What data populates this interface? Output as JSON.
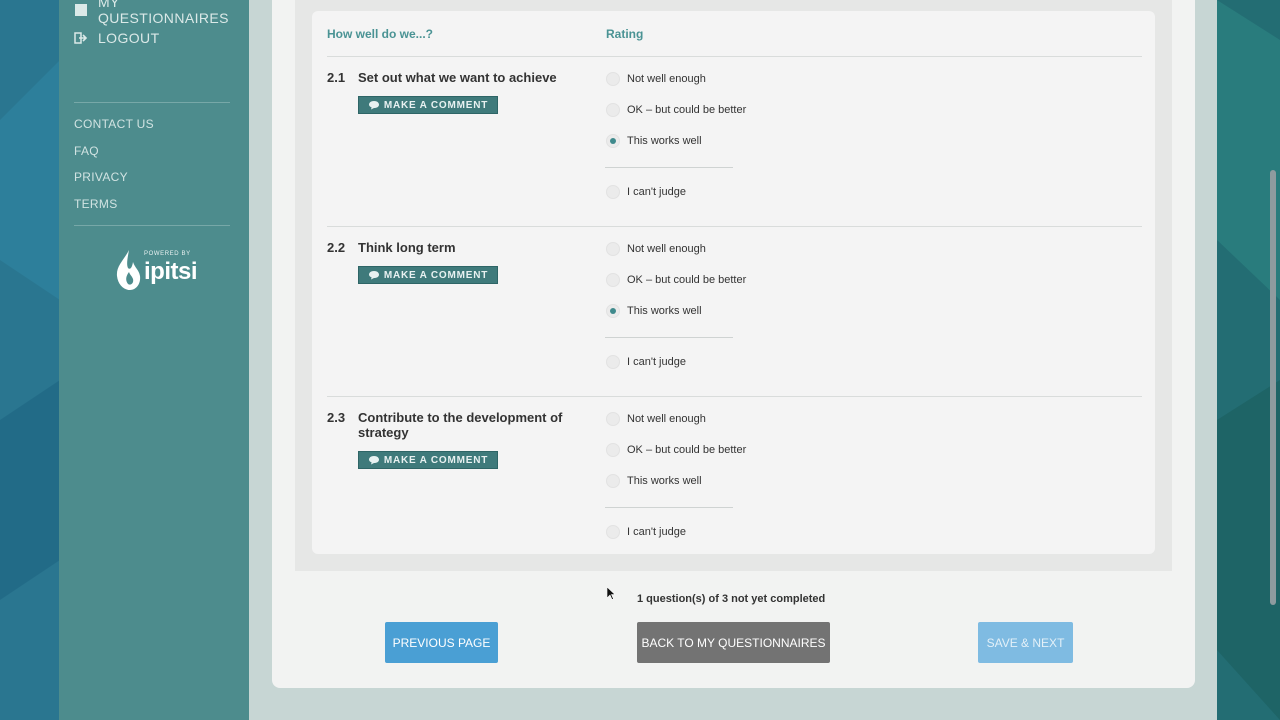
{
  "sidebar": {
    "nav": [
      {
        "label": "MY QUESTIONNAIRES",
        "icon": "square-icon"
      },
      {
        "label": "LOGOUT",
        "icon": "logout-icon"
      }
    ],
    "links": [
      "CONTACT US",
      "FAQ",
      "PRIVACY",
      "TERMS"
    ],
    "logo": {
      "powered_by": "POWERED BY",
      "brand": "ipitsi"
    }
  },
  "table": {
    "col_question": "How well do we...?",
    "col_rating": "Rating"
  },
  "comment_label": "MAKE A COMMENT",
  "questions": [
    {
      "num": "2.1",
      "text": "Set out what we want to achieve",
      "options": [
        "Not well enough",
        "OK – but could be better",
        "This works well",
        "I can't judge"
      ],
      "selected": "This works well"
    },
    {
      "num": "2.2",
      "text": "Think long term",
      "options": [
        "Not well enough",
        "OK – but could be better",
        "This works well",
        "I can't judge"
      ],
      "selected": "This works well"
    },
    {
      "num": "2.3",
      "text": "Contribute to the development of strategy",
      "options": [
        "Not well enough",
        "OK – but could be better",
        "This works well",
        "I can't judge"
      ],
      "selected": ""
    }
  ],
  "status": "1 question(s) of 3 not yet completed",
  "buttons": {
    "previous": "PREVIOUS PAGE",
    "back": "BACK TO MY QUESTIONNAIRES",
    "save": "SAVE & NEXT"
  },
  "colors": {
    "accent": "#4a9394",
    "sidebar": "#4d8c8d",
    "comment_button": "#3f7a7b",
    "primary_button": "#4a9fd4"
  }
}
